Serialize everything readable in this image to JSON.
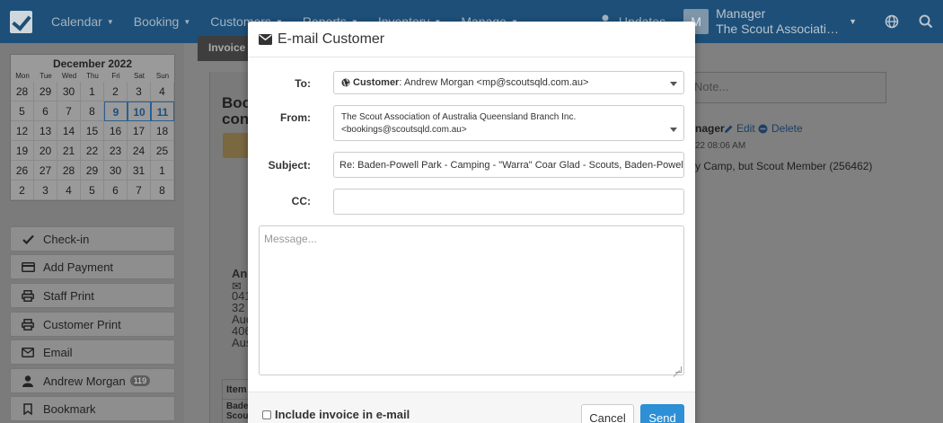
{
  "navbar": {
    "menu": [
      {
        "label": "Calendar"
      },
      {
        "label": "Booking"
      },
      {
        "label": "Customers"
      },
      {
        "label": "Reports"
      },
      {
        "label": "Inventory"
      },
      {
        "label": "Manage"
      }
    ],
    "updates_label": "Updates",
    "avatar_letter": "M",
    "user_name": "Manager",
    "user_org": "The Scout Association of Australia Queensland Branch Inc."
  },
  "calendar": {
    "title": "December 2022",
    "dow": [
      "Mon",
      "Tue",
      "Wed",
      "Thu",
      "Fri",
      "Sat",
      "Sun"
    ],
    "days": [
      "28",
      "29",
      "30",
      "1",
      "2",
      "3",
      "4",
      "5",
      "6",
      "7",
      "8",
      "9",
      "10",
      "11",
      "12",
      "13",
      "14",
      "15",
      "16",
      "17",
      "18",
      "19",
      "20",
      "21",
      "22",
      "23",
      "24",
      "25",
      "26",
      "27",
      "28",
      "29",
      "30",
      "31",
      "1",
      "2",
      "3",
      "4",
      "5",
      "6",
      "7",
      "8"
    ],
    "selected": [
      "9",
      "10",
      "11"
    ]
  },
  "sidebar": {
    "buttons": [
      {
        "label": "Check-in"
      },
      {
        "label": "Add Payment"
      },
      {
        "label": "Staff Print"
      },
      {
        "label": "Customer Print"
      },
      {
        "label": "Email"
      },
      {
        "label": "Andrew Morgan",
        "badge": "119"
      },
      {
        "label": "Bookmark"
      }
    ]
  },
  "background": {
    "invoice_tab": "Invoice",
    "title_line1": "Boo",
    "title_line2": "con",
    "contact_name": "And",
    "contact_lines": [
      "041",
      "32 I",
      "Auc",
      "406",
      "Aus"
    ],
    "table_header": "Item",
    "table_cell1": "Bade",
    "table_cell2": "Scou",
    "note_placeholder": "Note...",
    "manager_label": "nager",
    "edit_label": "Edit",
    "delete_label": "Delete",
    "timestamp": "22 08:06 AM",
    "note_text": "y Camp, but Scout Member (256462)"
  },
  "modal": {
    "title": "E-mail Customer",
    "to_label": "To:",
    "to_prefix": "Customer",
    "to_value": ": Andrew Morgan <mp@scoutsqld.com.au>",
    "from_label": "From:",
    "from_line1": "The Scout Association of Australia Queensland Branch Inc.",
    "from_line2": "<bookings@scoutsqld.com.au>",
    "subject_label": "Subject:",
    "subject_value": "Re: Baden-Powell Park - Camping - \"Warra\" Coar Glad - Scouts, Baden-Powell",
    "cc_label": "CC:",
    "cc_value": "",
    "message_placeholder": "Message...",
    "include_invoice_label": "Include invoice in e-mail",
    "cancel_label": "Cancel",
    "send_label": "Send"
  },
  "colors": {
    "navbar": "#1d4f78",
    "primary_button": "#2d8fd6",
    "overlay": "#808080"
  }
}
